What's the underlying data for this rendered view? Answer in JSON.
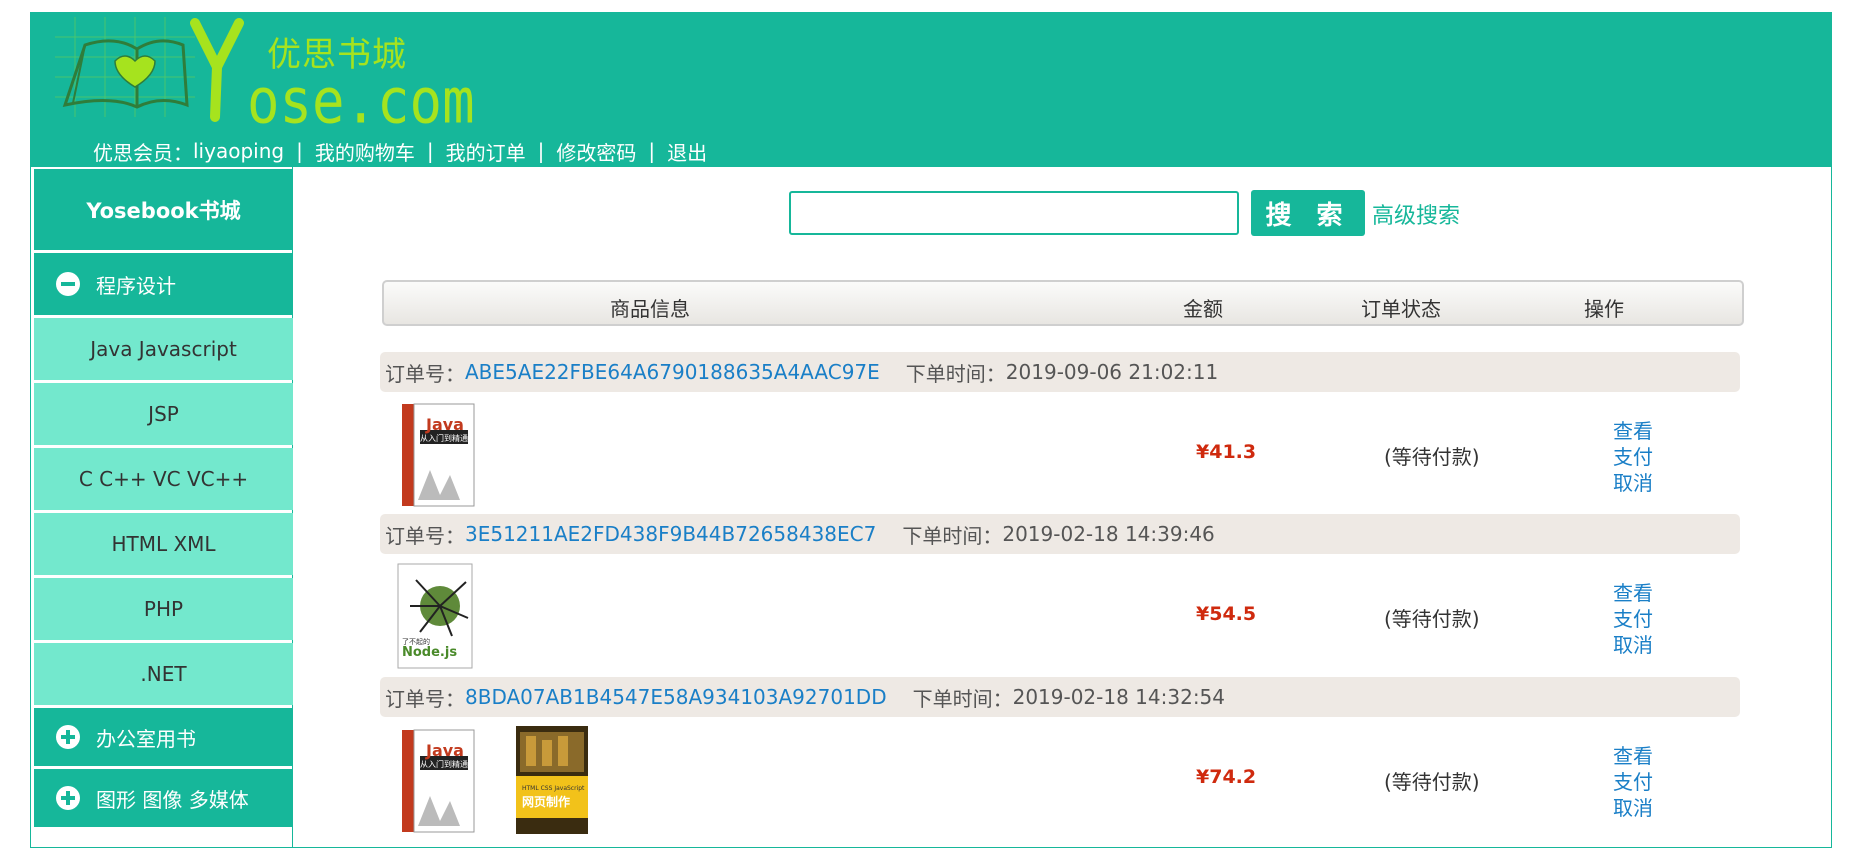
{
  "logo": {
    "cn": "优思书城",
    "en": "ose.com"
  },
  "topnav": {
    "member_label": "优思会员：",
    "username": "liyaoping",
    "separator": "|",
    "cart": "我的购物车",
    "orders": "我的订单",
    "change_password": "修改密码",
    "logout": "退出"
  },
  "sidebar": {
    "title": "Yosebook书城",
    "categories": [
      {
        "label": "程序设计",
        "expanded": true,
        "items": [
          "Java Javascript",
          "JSP",
          "C C++ VC VC++",
          "HTML XML",
          "PHP",
          ".NET"
        ]
      },
      {
        "label": "办公室用书",
        "expanded": false
      },
      {
        "label": "图形 图像 多媒体",
        "expanded": false
      }
    ]
  },
  "search": {
    "placeholder": "",
    "button": "搜 索",
    "advanced": "高级搜索"
  },
  "table_header": {
    "product": "商品信息",
    "amount": "金额",
    "status": "订单状态",
    "action": "操作"
  },
  "order_labels": {
    "id_label": "订单号：",
    "time_label": "下单时间："
  },
  "orders": [
    {
      "id": "ABE5AE22FBE64A6790188635A4AAC97E",
      "time": "2019-09-06 21:02:11",
      "books": [
        {
          "title": "Java",
          "subtitle": "从入门到精通"
        }
      ],
      "price": "¥41.3",
      "status": "(等待付款)",
      "actions": [
        "查看",
        "支付",
        "取消"
      ]
    },
    {
      "id": "3E51211AE2FD438F9B44B72658438EC7",
      "time": "2019-02-18 14:39:46",
      "books": [
        {
          "title": "Node.js",
          "subtitle": "了不起的"
        }
      ],
      "price": "¥54.5",
      "status": "(等待付款)",
      "actions": [
        "查看",
        "支付",
        "取消"
      ]
    },
    {
      "id": "8BDA07AB1B4547E58A934103A92701DD",
      "time": "2019-02-18 14:32:54",
      "books": [
        {
          "title": "Java",
          "subtitle": "从入门到精通"
        },
        {
          "title": "HTML CSS JavaScript",
          "subtitle": "网页制作"
        }
      ],
      "price": "¥74.2",
      "status": "(等待付款)",
      "actions": [
        "查看",
        "支付",
        "取消"
      ]
    }
  ],
  "colors": {
    "primary": "#16b79a",
    "sub_item_bg": "#73e8cd",
    "link": "#1a7fc7",
    "price": "#cf2a0e",
    "order_bar": "#eee9e4"
  }
}
